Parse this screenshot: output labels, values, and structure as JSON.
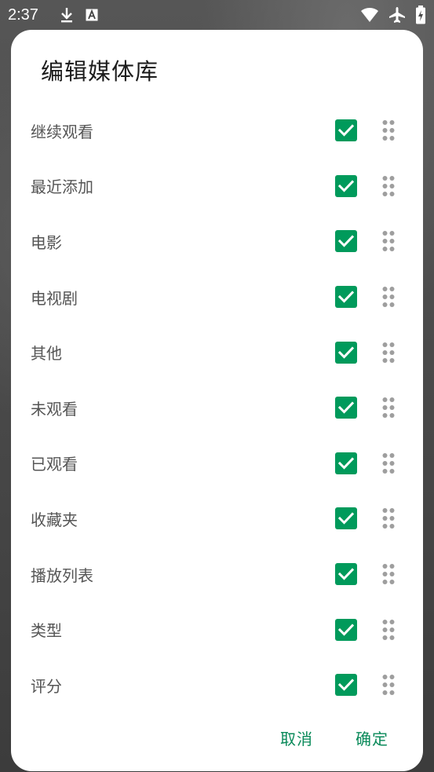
{
  "status_bar": {
    "time": "2:37",
    "left_icons": [
      "download-icon",
      "font-a-icon"
    ],
    "right_icons": [
      "wifi-icon",
      "airplane-icon",
      "battery-icon"
    ]
  },
  "dialog": {
    "title": "编辑媒体库",
    "items": [
      {
        "label": "继续观看",
        "checked": true
      },
      {
        "label": "最近添加",
        "checked": true
      },
      {
        "label": "电影",
        "checked": true
      },
      {
        "label": "电视剧",
        "checked": true
      },
      {
        "label": "其他",
        "checked": true
      },
      {
        "label": "未观看",
        "checked": true
      },
      {
        "label": "已观看",
        "checked": true
      },
      {
        "label": "收藏夹",
        "checked": true
      },
      {
        "label": "播放列表",
        "checked": true
      },
      {
        "label": "类型",
        "checked": true
      },
      {
        "label": "评分",
        "checked": true
      }
    ],
    "cancel_label": "取消",
    "confirm_label": "确定"
  },
  "colors": {
    "accent": "#009a5b",
    "action_text": "#0a8a5a",
    "label_text": "#555555"
  }
}
